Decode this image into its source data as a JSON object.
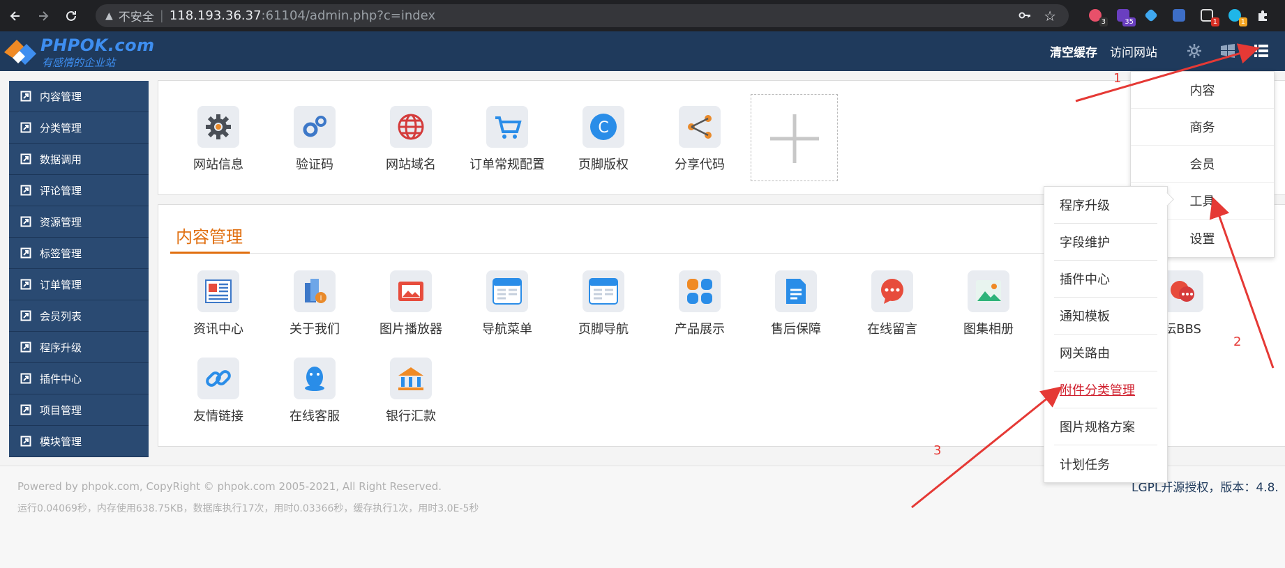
{
  "browser": {
    "insecure_label": "不安全",
    "url_host": "118.193.36.37",
    "url_rest": ":61104/admin.php?c=index",
    "extension_badges": [
      "3",
      "35",
      "1",
      "1"
    ]
  },
  "header": {
    "logo_name": "PHPOK.com",
    "logo_slogan": "有感情的企业站",
    "clear_cache": "清空缓存",
    "visit_site": "访问网站"
  },
  "sidebar": {
    "items": [
      {
        "label": "内容管理"
      },
      {
        "label": "分类管理"
      },
      {
        "label": "数据调用"
      },
      {
        "label": "评论管理"
      },
      {
        "label": "资源管理"
      },
      {
        "label": "标签管理"
      },
      {
        "label": "订单管理"
      },
      {
        "label": "会员列表"
      },
      {
        "label": "程序升级"
      },
      {
        "label": "插件中心"
      },
      {
        "label": "项目管理"
      },
      {
        "label": "模块管理"
      }
    ]
  },
  "quick": {
    "items": [
      {
        "label": "网站信息",
        "icon": "gear-icon"
      },
      {
        "label": "验证码",
        "icon": "gears-icon"
      },
      {
        "label": "网站域名",
        "icon": "globe-icon"
      },
      {
        "label": "订单常规配置",
        "icon": "cart-icon"
      },
      {
        "label": "页脚版权",
        "icon": "copyright-icon"
      },
      {
        "label": "分享代码",
        "icon": "share-icon"
      }
    ]
  },
  "content": {
    "title": "内容管理",
    "items": [
      {
        "label": "资讯中心",
        "icon": "news-icon"
      },
      {
        "label": "关于我们",
        "icon": "about-icon"
      },
      {
        "label": "图片播放器",
        "icon": "image-player-icon"
      },
      {
        "label": "导航菜单",
        "icon": "nav-menu-icon"
      },
      {
        "label": "页脚导航",
        "icon": "footer-nav-icon"
      },
      {
        "label": "产品展示",
        "icon": "product-icon"
      },
      {
        "label": "售后保障",
        "icon": "document-icon"
      },
      {
        "label": "在线留言",
        "icon": "message-icon"
      },
      {
        "label": "图集相册",
        "icon": "album-icon"
      },
      {
        "label": "坛BBS",
        "icon": "chat-icon"
      },
      {
        "label": "友情链接",
        "icon": "link-icon"
      },
      {
        "label": "在线客服",
        "icon": "qq-icon"
      },
      {
        "label": "银行汇款",
        "icon": "bank-icon"
      }
    ]
  },
  "dropdown": {
    "items": [
      {
        "label": "内容"
      },
      {
        "label": "商务"
      },
      {
        "label": "会员"
      },
      {
        "label": "工具"
      },
      {
        "label": "设置"
      }
    ]
  },
  "submenu": {
    "items": [
      {
        "label": "程序升级"
      },
      {
        "label": "字段维护"
      },
      {
        "label": "插件中心"
      },
      {
        "label": "通知模板"
      },
      {
        "label": "网关路由"
      },
      {
        "label": "附件分类管理",
        "active": true
      },
      {
        "label": "图片规格方案"
      },
      {
        "label": "计划任务"
      }
    ]
  },
  "footer": {
    "copyright": "Powered by phpok.com, CopyRight © phpok.com 2005-2021, All Right Reserved.",
    "stats": "运行0.04069秒，内存使用638.75KB，数据库执行17次，用时0.03366秒，缓存执行1次，用时3.0E-5秒",
    "license": "LGPL开源授权，版本：4.8."
  },
  "annotations": {
    "a1": "1",
    "a2": "2",
    "a3": "3"
  },
  "colors": {
    "header_bg": "#1f3a5c",
    "sidebar_bg": "#2a4a72",
    "accent_orange": "#e06f10",
    "active_red": "#d0202e",
    "annotation_red": "#e53935"
  }
}
